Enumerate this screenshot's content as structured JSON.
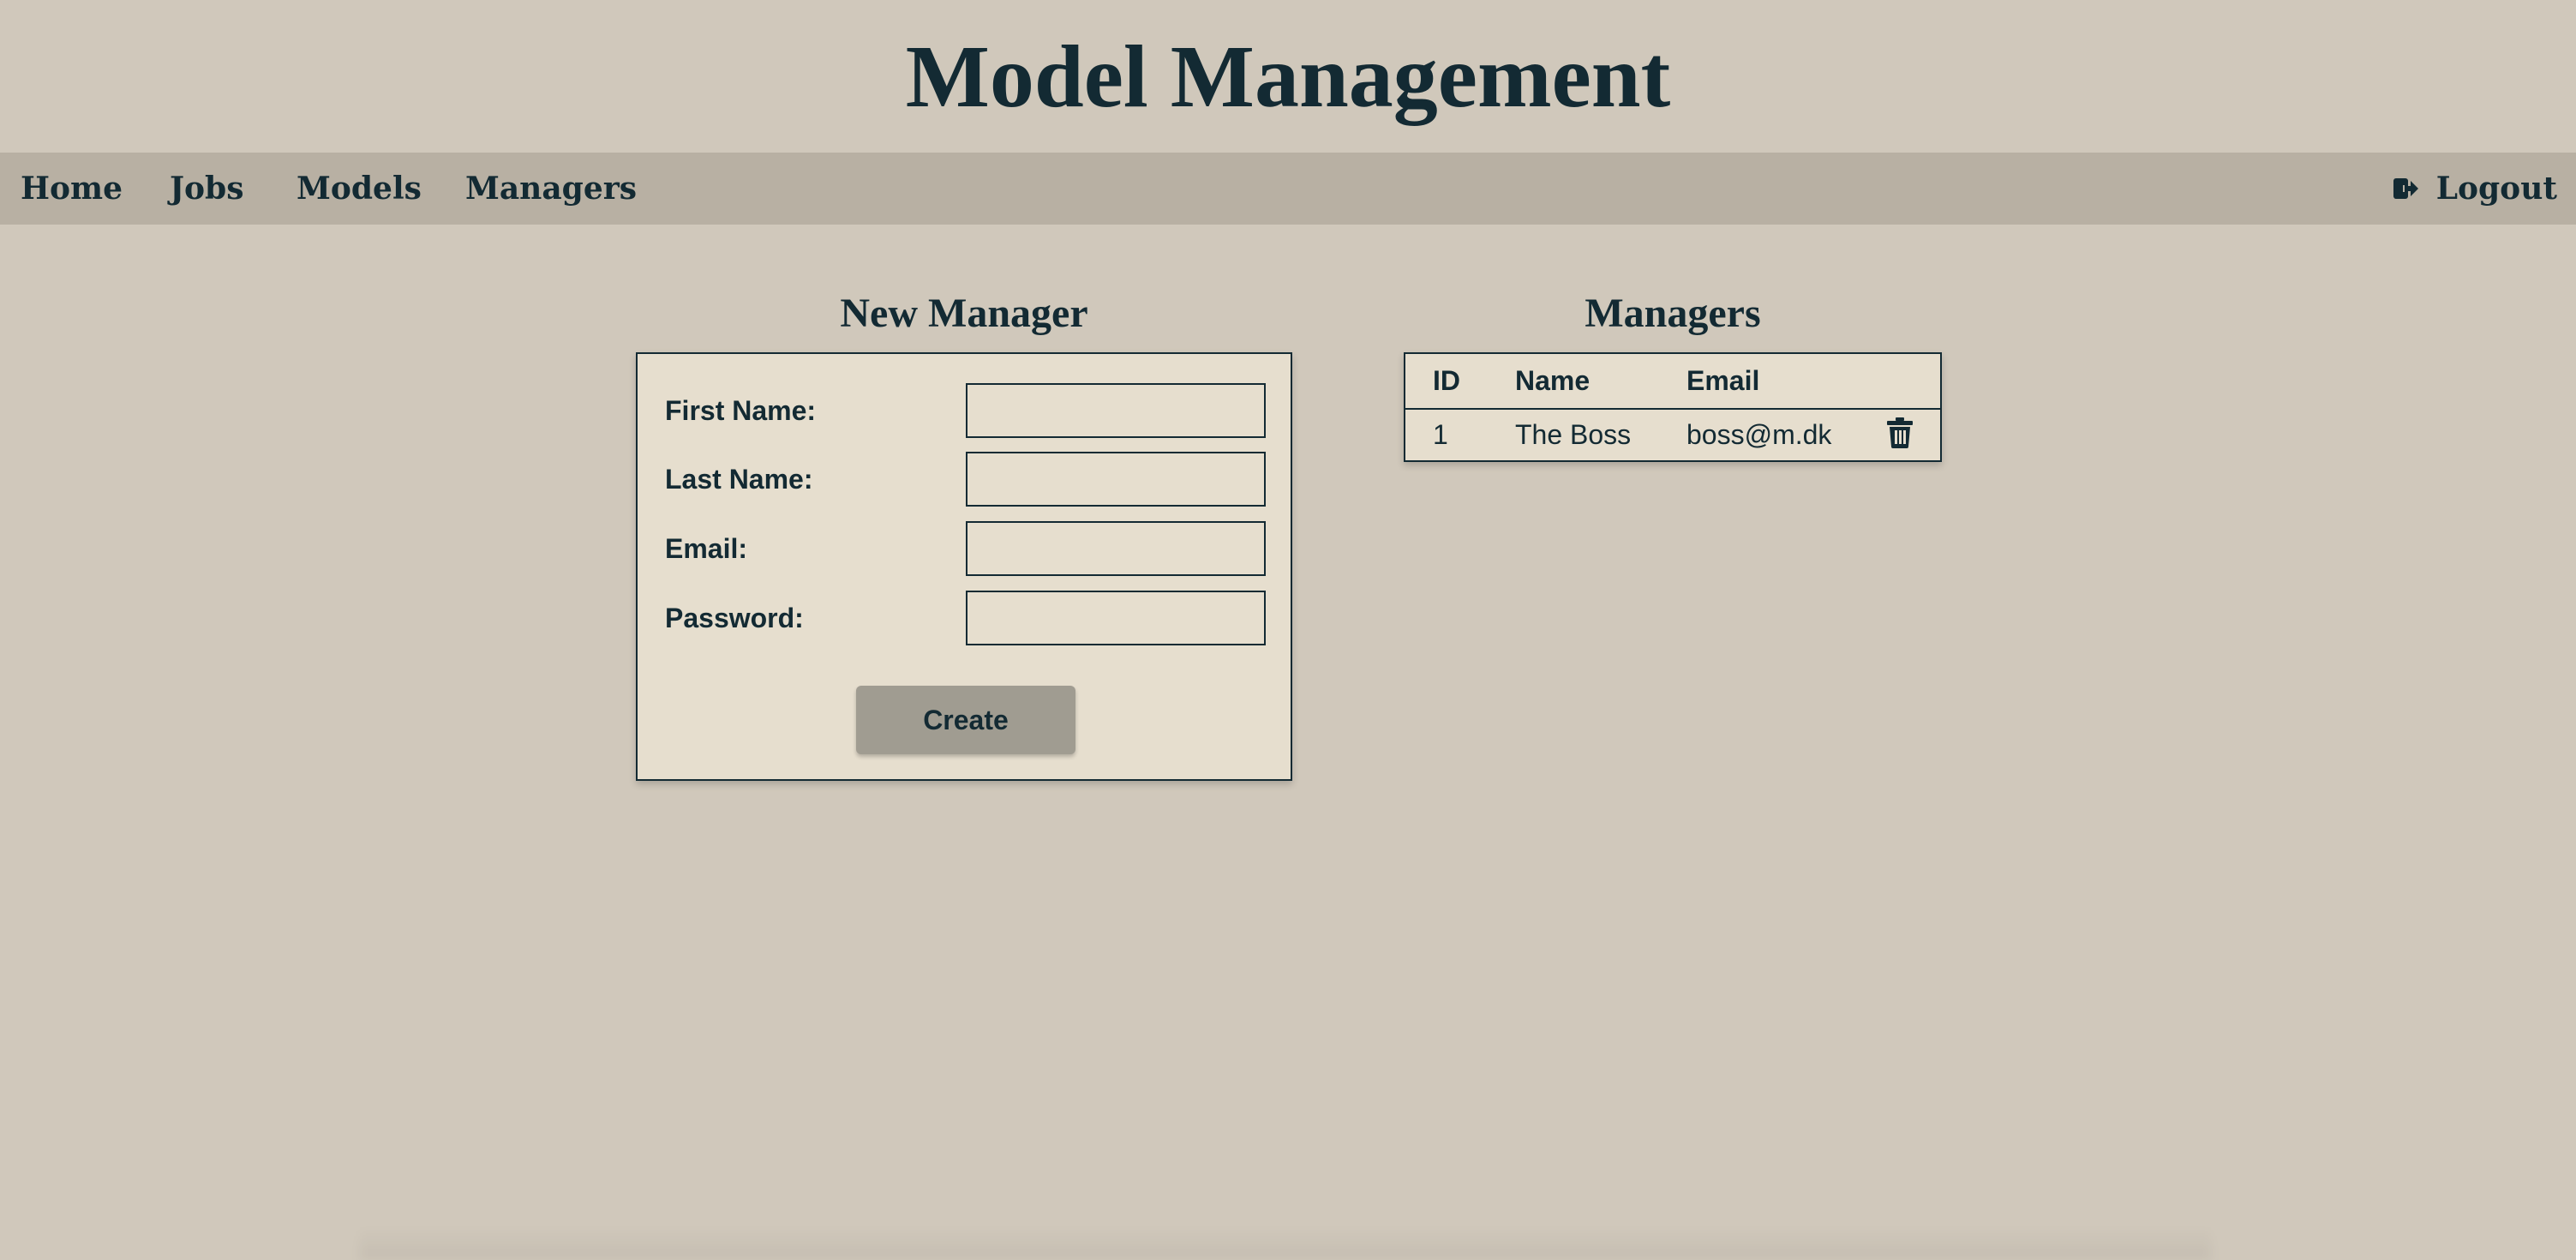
{
  "app": {
    "title": "Model Management"
  },
  "nav": {
    "items": [
      {
        "label": "Home"
      },
      {
        "label": "Jobs"
      },
      {
        "label": "Models"
      },
      {
        "label": "Managers"
      }
    ],
    "logout": {
      "label": "Logout",
      "icon": "logout-icon"
    }
  },
  "form": {
    "title": "New Manager",
    "fields": [
      {
        "label": "First Name:",
        "value": "",
        "placeholder": ""
      },
      {
        "label": "Last Name:",
        "value": "",
        "placeholder": ""
      },
      {
        "label": "Email:",
        "value": "",
        "placeholder": ""
      },
      {
        "label": "Password:",
        "value": "",
        "placeholder": ""
      }
    ],
    "submit_label": "Create"
  },
  "table": {
    "title": "Managers",
    "columns": [
      "ID",
      "Name",
      "Email"
    ],
    "rows": [
      {
        "id": "1",
        "name": "The Boss",
        "email": "boss@m.dk",
        "action_icon": "trash-icon"
      }
    ]
  },
  "colors": {
    "background": "#d0c8bb",
    "navbar": "#b8b0a3",
    "panel": "#e6dece",
    "text": "#132a33",
    "button": "#a09c91"
  }
}
